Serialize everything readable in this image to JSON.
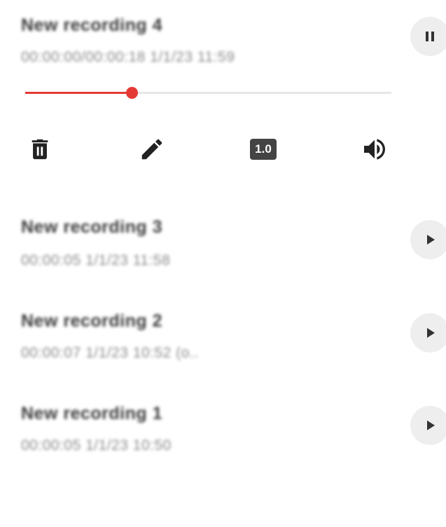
{
  "recordings": [
    {
      "title": "New recording 4",
      "meta": "00:00:00/00:00:18   1/1/23 11:59",
      "state": "playing"
    },
    {
      "title": "New recording 3",
      "meta": "00:00:05   1/1/23 11:58",
      "state": "stopped"
    },
    {
      "title": "New recording 2",
      "meta": "00:00:07   1/1/23 10:52   (o..",
      "state": "stopped"
    },
    {
      "title": "New recording 1",
      "meta": "00:00:05   1/1/23 10:50",
      "state": "stopped"
    }
  ],
  "player": {
    "progress_fraction": 0.29,
    "speed_label": "1.0",
    "accent_color": "#e53935"
  },
  "icons": {
    "pause": "pause-icon",
    "play": "play-icon",
    "delete": "trash-icon",
    "rename": "pencil-icon",
    "speed": "speed-icon",
    "volume": "volume-icon"
  }
}
